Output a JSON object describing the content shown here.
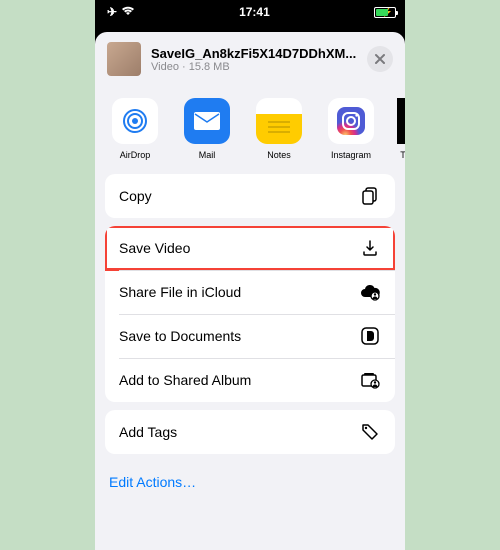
{
  "status": {
    "time": "17:41"
  },
  "header": {
    "title": "SaveIG_An8kzFi5X14D7DDhXM...",
    "subtitle": "Video · 15.8 MB"
  },
  "targets": [
    {
      "key": "airdrop",
      "label": "AirDrop"
    },
    {
      "key": "mail",
      "label": "Mail"
    },
    {
      "key": "notes",
      "label": "Notes"
    },
    {
      "key": "instagram",
      "label": "Instagram"
    },
    {
      "key": "partial",
      "label": "T"
    }
  ],
  "actions": {
    "copy": "Copy",
    "save_video": "Save Video",
    "share_icloud": "Share File in iCloud",
    "save_docs": "Save to Documents",
    "add_shared": "Add to Shared Album",
    "add_tags": "Add Tags"
  },
  "edit": {
    "label": "Edit Actions…"
  },
  "highlight": "save_video"
}
